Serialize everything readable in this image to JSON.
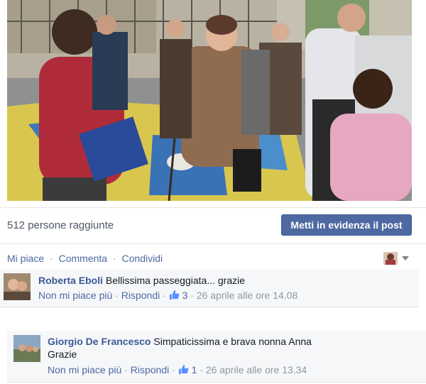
{
  "post": {
    "reach_text": "512 persone raggiunte",
    "boost_button": "Metti in evidenza il post"
  },
  "actions": {
    "like": "Mi piace",
    "comment": "Commenta",
    "share": "Condividi",
    "separator": "·"
  },
  "comments": [
    {
      "author": "Roberta Eboli",
      "text": "Bellissima passeggiata... grazie",
      "unlike": "Non mi piace più",
      "reply": "Rispondi",
      "likes": "3",
      "timestamp": "26 aprile alle ore 14.08"
    },
    {
      "author": "Giorgio De Francesco",
      "text": "Simpaticissima e brava nonna Anna",
      "text2": "Grazie",
      "unlike": "Non mi piace più",
      "reply": "Rispondi",
      "likes": "1",
      "timestamp": "26 aprile alle ore 13.34"
    }
  ],
  "colors": {
    "link": "#4e69a2",
    "name": "#3b5998",
    "button_bg": "#4e69a2",
    "meta": "#9197a3",
    "comment_bg": "#f6f7f9"
  },
  "icons": [
    "thumbs-up-icon",
    "caret-down-icon"
  ]
}
